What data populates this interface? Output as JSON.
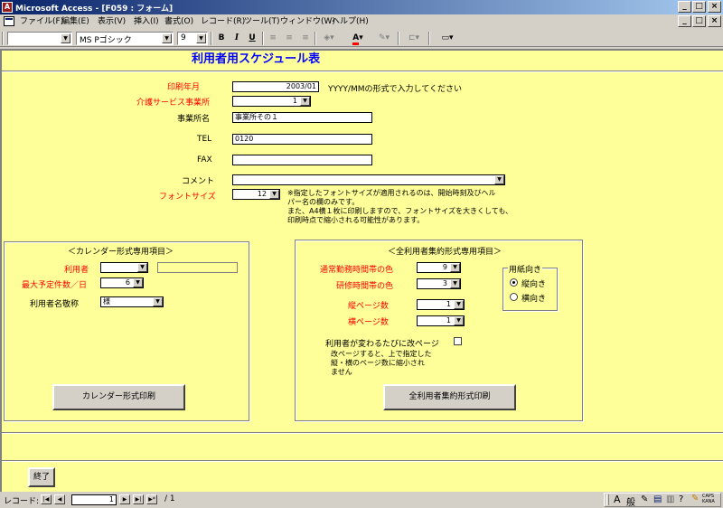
{
  "window": {
    "title": "Microsoft Access - [F059 : フォーム]",
    "app_icon": "access-icon",
    "controls": [
      "_",
      "□",
      "×"
    ],
    "doc_controls": [
      "_",
      "□",
      "×"
    ]
  },
  "menu": [
    "ファイル(F)",
    "編集(E)",
    "表示(V)",
    "挿入(I)",
    "書式(O)",
    "レコード(R)",
    "ツール(T)",
    "ウィンドウ(W)",
    "ヘルプ(H)"
  ],
  "toolbar": {
    "object_combo": "",
    "font_combo": "MS Pゴシック",
    "size_combo": "9",
    "bold": "B",
    "italic": "I",
    "underline": "U",
    "font_color_icon": "A"
  },
  "form": {
    "title": "利用者用スケジュール表",
    "print_month_label": "印刷年月",
    "print_month_value": "2003/01",
    "print_month_hint": "YYYY/MMの形式で入力してください",
    "care_service_label": "介護サービス事業所",
    "care_service_value": "1",
    "office_name_label": "事業所名",
    "office_name_value": "事業所その１",
    "tel_label": "TEL",
    "tel_value": "0120",
    "fax_label": "FAX",
    "fax_value": "",
    "comment_label": "コメント",
    "comment_value": "",
    "font_size_label": "フォントサイズ",
    "font_size_value": "12",
    "font_size_note": "※指定したフォントサイズが適用されるのは、開始時刻及びヘル\nパー名の欄のみです。\nまた、A4横１枚に印刷しますので、フォントサイズを大きくしても、\n印刷時点で縮小される可能性があります。",
    "calendar_group": {
      "title": "＜カレンダー形式専用項目＞",
      "user_label": "利用者",
      "user_value": "",
      "user_name_value": "",
      "max_planned_label": "最大予定件数／日",
      "max_planned_value": "6",
      "user_honorific_label": "利用者名敬称",
      "user_honorific_value": "様",
      "print_button": "カレンダー形式印刷"
    },
    "summary_group": {
      "title": "＜全利用者集約形式専用項目＞",
      "normal_color_label": "通常勤務時間帯の色",
      "normal_color_value": "9",
      "training_color_label": "研修時間帯の色",
      "training_color_value": "3",
      "vertical_pages_label": "縦ページ数",
      "vertical_pages_value": "1",
      "horizontal_pages_label": "横ページ数",
      "horizontal_pages_value": "1",
      "orientation_title": "用紙向き",
      "orientation_options": [
        "縦向き",
        "横向き"
      ],
      "orientation_selected": "縦向き",
      "page_break_label": "利用者が変わるたびに改ページ",
      "page_break_checked": false,
      "page_note": "改ページすると、上で指定した\n縦・横のページ数に縮小され\nません",
      "print_button": "全利用者集約形式印刷"
    },
    "exit_button": "終了"
  },
  "navigation": {
    "record_label": "レコード:",
    "current_record": "1",
    "total_label": "/ 1"
  },
  "ime_bar": {
    "items": [
      "A",
      "般",
      "CAPS",
      "KANA"
    ]
  }
}
